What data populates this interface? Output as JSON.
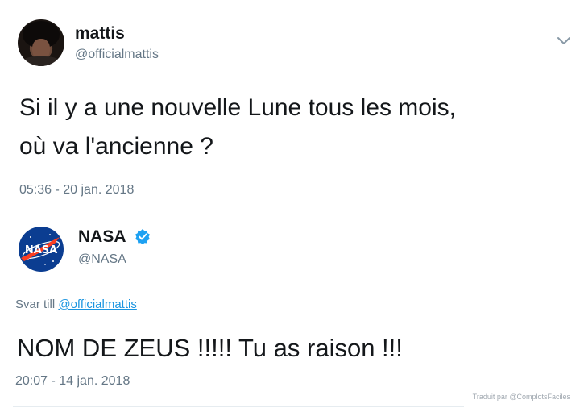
{
  "tweet1": {
    "author_name": "mattis",
    "author_handle": "@officialmattis",
    "text_line1": "Si il y a une nouvelle Lune tous les mois,",
    "text_line2": "où va l'ancienne ?",
    "timestamp": "05:36 - 20 jan. 2018",
    "menu_icon": "chevron-down-icon"
  },
  "tweet2": {
    "author_name": "NASA",
    "author_handle": "@NASA",
    "verified_icon": "verified-badge-icon",
    "reply_prefix": "Svar till",
    "reply_to": "@officialmattis",
    "text": "NOM DE ZEUS !!!!! Tu as raison !!!",
    "timestamp": "20:07 - 14 jan. 2018"
  },
  "watermark": "Traduit par @ComplotsFaciles",
  "colors": {
    "text": "#14171a",
    "secondary": "#657786",
    "link": "#1b95e0",
    "verified": "#1da1f2",
    "nasa_blue": "#0b3d91",
    "nasa_red": "#fc3d21"
  }
}
